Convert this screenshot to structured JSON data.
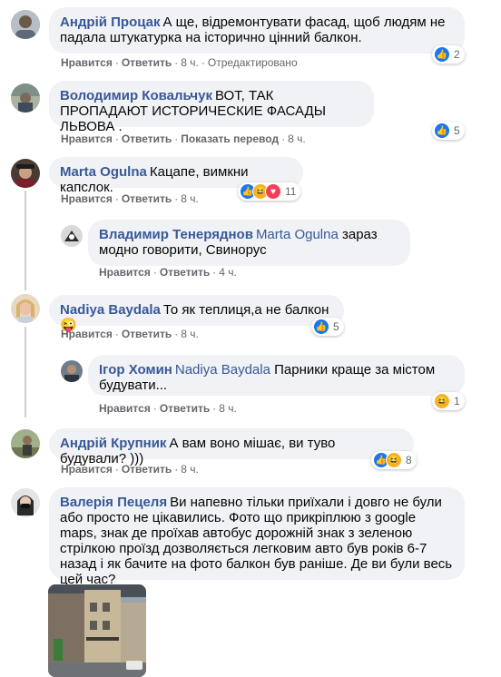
{
  "colors": {
    "link": "#385898",
    "meta": "#65676b",
    "bubble": "#f0f2f5",
    "like": "#1877f2",
    "haha": "#f7b125",
    "love": "#f33e58"
  },
  "comments": [
    {
      "author": "Андрій Процак",
      "text": "А ще, відремонтувати фасад, щоб людям не падала штукатурка на історично цінний балкон.",
      "actions": [
        "Нравится",
        "Ответить"
      ],
      "time": "8 ч.",
      "extra": "Отредактировано",
      "reaction_icons": [
        "like-icon"
      ],
      "reaction_count": "2"
    },
    {
      "author": "Володимир Ковальчук",
      "text": "ВОТ, ТАК ПРОПАДАЮТ ИСТОРИЧЕСКИЕ ФАСАДЫ ЛЬВОВА .",
      "actions": [
        "Нравится",
        "Ответить",
        "Показать перевод"
      ],
      "time": "8 ч.",
      "reaction_icons": [
        "like-icon"
      ],
      "reaction_count": "5"
    },
    {
      "author": "Marta Ogulna",
      "text": "Кацапе, вимкни капслок.",
      "actions": [
        "Нравится",
        "Ответить"
      ],
      "time": "8 ч.",
      "reaction_icons": [
        "like-icon",
        "haha-icon",
        "love-icon"
      ],
      "reaction_count": "11"
    },
    {
      "author": "Владимир Тенеряднов",
      "mention": "Marta Ogulna",
      "text": "зараз модно говорити, Свинорус",
      "actions": [
        "Нравится",
        "Ответить"
      ],
      "time": "4 ч."
    },
    {
      "author": "Nadiya Baydala",
      "text": "То як теплиця,а не балкон",
      "emoji": "😜",
      "actions": [
        "Нравится",
        "Ответить"
      ],
      "time": "8 ч.",
      "reaction_icons": [
        "like-icon"
      ],
      "reaction_count": "5"
    },
    {
      "author": "Ігор Хомин",
      "mention": "Nadiya Baydala",
      "text": "Парники краще за містом будувати...",
      "actions": [
        "Нравится",
        "Ответить"
      ],
      "time": "8 ч.",
      "reaction_icons": [
        "haha-icon"
      ],
      "reaction_count": "1"
    },
    {
      "author": "Андрій Крупник",
      "text": "А вам воно мішає, ви туво будували? )))",
      "actions": [
        "Нравится",
        "Ответить"
      ],
      "time": "8 ч.",
      "reaction_icons": [
        "like-icon",
        "haha-icon"
      ],
      "reaction_count": "8"
    },
    {
      "author": "Валерія Пецеля",
      "text": "Ви напевно тільки приїхали і довго не були або просто не цікавились. Фото що прикріплюю з google maps, знак де проїхав автобус дорожній знак з зеленою стрілкою проїзд дозволяється легковим авто був років 6-7 назад і як бачите на фото балкон був раніше. Де ви були весь цей час?"
    }
  ]
}
